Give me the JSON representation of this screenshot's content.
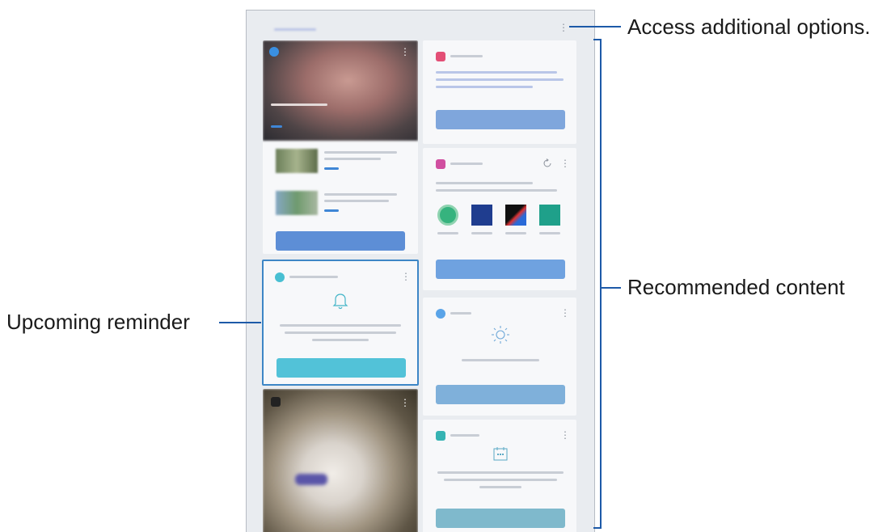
{
  "callouts": {
    "additional_options": "Access additional options.",
    "recommended_content": "Recommended content",
    "upcoming_reminder": "Upcoming reminder"
  },
  "icons": {
    "more_options": "more-vertical-icon",
    "bell": "bell-icon",
    "sun": "sun-icon",
    "calendar": "calendar-icon",
    "refresh": "refresh-icon"
  },
  "colors": {
    "callout_line": "#1d5aa8",
    "button_blue": "#7fa6dc",
    "reminder_teal": "#52c2d8",
    "highlight_border": "#3d86c6"
  }
}
